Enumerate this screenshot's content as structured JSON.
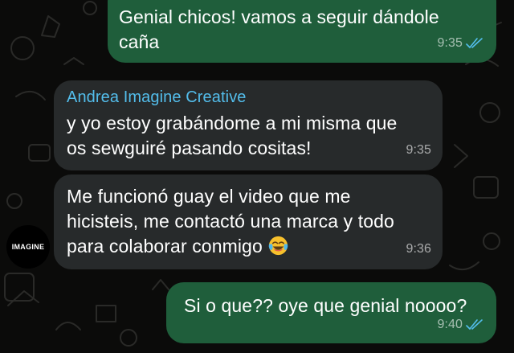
{
  "chat": {
    "messages": [
      {
        "direction": "outgoing",
        "text": "Genial chicos! vamos a seguir dándole\ncaña",
        "time": "9:35",
        "status": "read"
      },
      {
        "direction": "incoming",
        "sender": "Andrea Imagine Creative",
        "text": "y yo estoy grabándome a mi misma que\nos sewguiré pasando cositas!",
        "time": "9:35"
      },
      {
        "direction": "incoming",
        "text": "Me funcionó guay el video que me\nhicisteis, me contactó una marca y todo\npara colaborar conmigo ",
        "emoji": "face-with-tears-of-joy-icon",
        "time": "9:36"
      },
      {
        "direction": "outgoing",
        "text": "Si o que?? oye que genial noooo?",
        "time": "9:40",
        "status": "read"
      }
    ],
    "avatar_label": "IMAGINE"
  },
  "colors": {
    "background": "#0b0b0a",
    "outgoing_bubble": "#1f5e3b",
    "incoming_bubble": "#272a2b",
    "sender_name": "#53bdeb",
    "read_ticks": "#53bdeb"
  }
}
